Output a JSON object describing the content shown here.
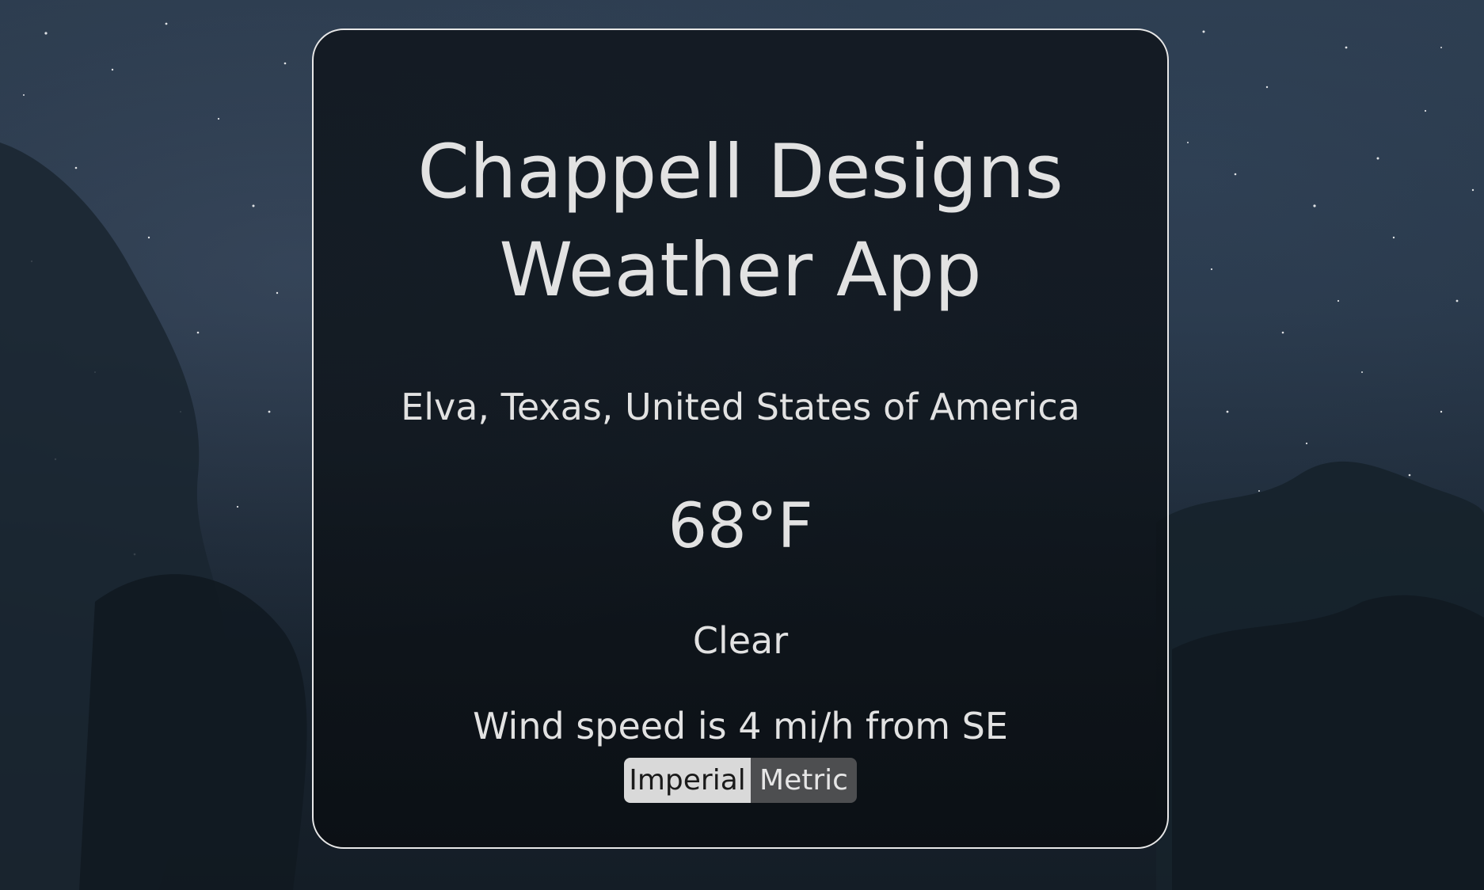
{
  "app": {
    "title_line1": "Chappell Designs",
    "title_line2": "Weather App"
  },
  "weather": {
    "location": "Elva, Texas, United States of America",
    "temperature": "68°F",
    "condition": "Clear",
    "wind": "Wind speed is 4 mi/h from SE"
  },
  "units_toggle": {
    "imperial_label": "Imperial",
    "metric_label": "Metric",
    "selected": "Imperial"
  },
  "colors": {
    "card_border": "#e8e8e8",
    "text": "#e2e2e2",
    "toggle_selected_bg": "#d9d9d9",
    "toggle_unselected_bg": "#4d4e50"
  }
}
